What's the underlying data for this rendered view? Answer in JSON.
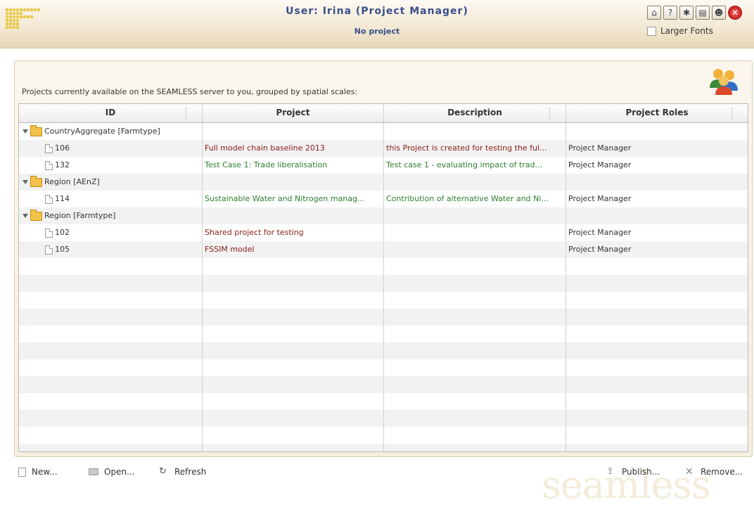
{
  "header": {
    "title": "User: Irina (Project Manager)",
    "subtitle": "No project",
    "larger_fonts_label": "Larger Fonts",
    "tool_icons": [
      "home-icon",
      "help-icon",
      "bug-icon",
      "book-icon",
      "users-icon",
      "close-icon"
    ]
  },
  "panel": {
    "description": "Projects currently available on the SEAMLESS server to you, grouped by spatial scales:"
  },
  "grid": {
    "columns": [
      "ID",
      "Project",
      "Description",
      "Project Roles"
    ],
    "rows": [
      {
        "type": "group",
        "id": "CountryAggregate [Farmtype]",
        "project": "",
        "description": "",
        "role": ""
      },
      {
        "type": "item",
        "id": "106",
        "project": "Full model chain baseline 2013",
        "description": "this Project is created for testing the ful...",
        "role": "Project Manager",
        "color": "red"
      },
      {
        "type": "item",
        "id": "132",
        "project": "Test Case 1: Trade liberalisation",
        "description": "Test case 1  - evaluating impact of trad...",
        "role": "Project Manager",
        "color": "green"
      },
      {
        "type": "group",
        "id": "Region [AEnZ]",
        "project": "",
        "description": "",
        "role": ""
      },
      {
        "type": "item",
        "id": "114",
        "project": "Sustainable Water and Nitrogen manag...",
        "description": "Contribution of alternative Water and Ni...",
        "role": "Project Manager",
        "color": "green"
      },
      {
        "type": "group",
        "id": "Region [Farmtype]",
        "project": "",
        "description": "",
        "role": ""
      },
      {
        "type": "item",
        "id": "102",
        "project": "Shared project for testing",
        "description": "",
        "role": "Project Manager",
        "color": "red"
      },
      {
        "type": "item",
        "id": "105",
        "project": "FSSIM model",
        "description": "",
        "role": "Project Manager",
        "color": "red"
      }
    ]
  },
  "toolbar": {
    "new_label": "New...",
    "open_label": "Open...",
    "refresh_label": "Refresh",
    "publish_label": "Publish...",
    "remove_label": "Remove...",
    "watermark": "seamless"
  }
}
